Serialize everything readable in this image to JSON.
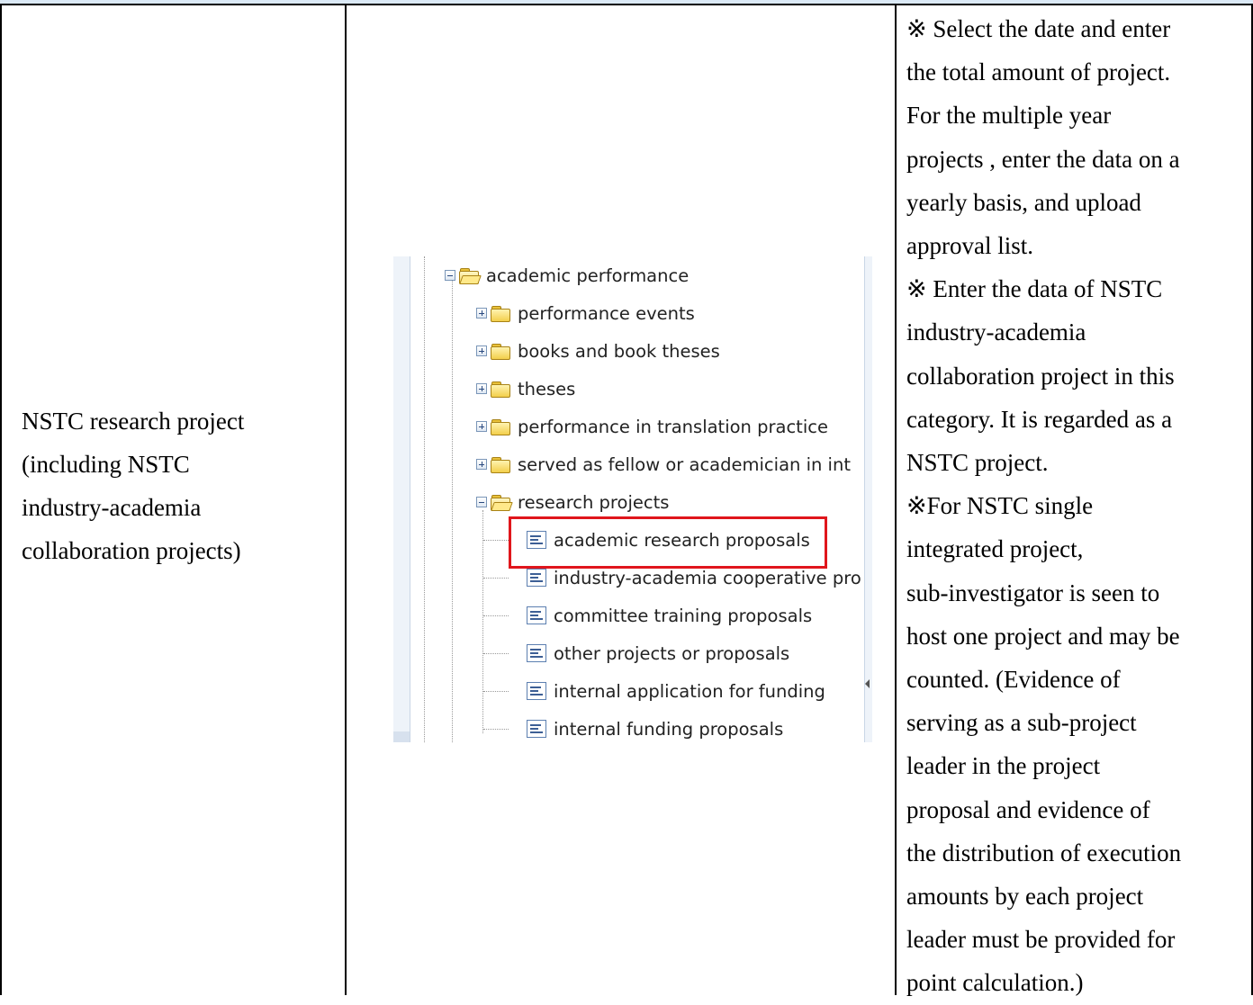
{
  "row": {
    "category_lines": [
      "NSTC research project",
      "(including NSTC",
      "industry-academia",
      "collaboration projects)"
    ],
    "note_lines": [
      "※ Select the date and enter",
      "the total amount of project.",
      "For the multiple year",
      "projects , enter the data on a",
      "yearly basis, and upload",
      "approval list.",
      "※ Enter the data of NSTC",
      "industry-academia",
      "collaboration project in this",
      "category. It is regarded as a",
      "NSTC project.",
      "※For NSTC single",
      "integrated project,",
      "sub-investigator is seen to",
      "host one project and may be",
      "counted. (Evidence of",
      "serving as a sub-project",
      "leader in the project",
      "proposal and evidence of",
      "the distribution of execution",
      "amounts by each project",
      "leader must be provided for",
      "point calculation.)"
    ]
  },
  "tree": {
    "root": {
      "label": "academic performance",
      "icon": "folder-open-icon"
    },
    "children": [
      {
        "label": "performance events",
        "icon": "folder-icon"
      },
      {
        "label": "books and book theses",
        "icon": "folder-icon"
      },
      {
        "label": "theses",
        "icon": "folder-icon"
      },
      {
        "label": "performance in translation practice",
        "icon": "folder-icon"
      },
      {
        "label": "served as fellow or academician in int",
        "icon": "folder-icon"
      },
      {
        "label": "research projects",
        "icon": "folder-open-icon"
      }
    ],
    "research_items": [
      {
        "label": "academic research proposals",
        "icon": "document-icon",
        "highlighted": true
      },
      {
        "label": "industry-academia cooperative pro",
        "icon": "document-icon"
      },
      {
        "label": "committee training proposals",
        "icon": "document-icon"
      },
      {
        "label": "other projects or proposals",
        "icon": "document-icon"
      },
      {
        "label": "internal application for funding",
        "icon": "document-icon"
      },
      {
        "label": "internal funding proposals",
        "icon": "document-icon"
      }
    ],
    "highlight_color": "#e0161c"
  }
}
